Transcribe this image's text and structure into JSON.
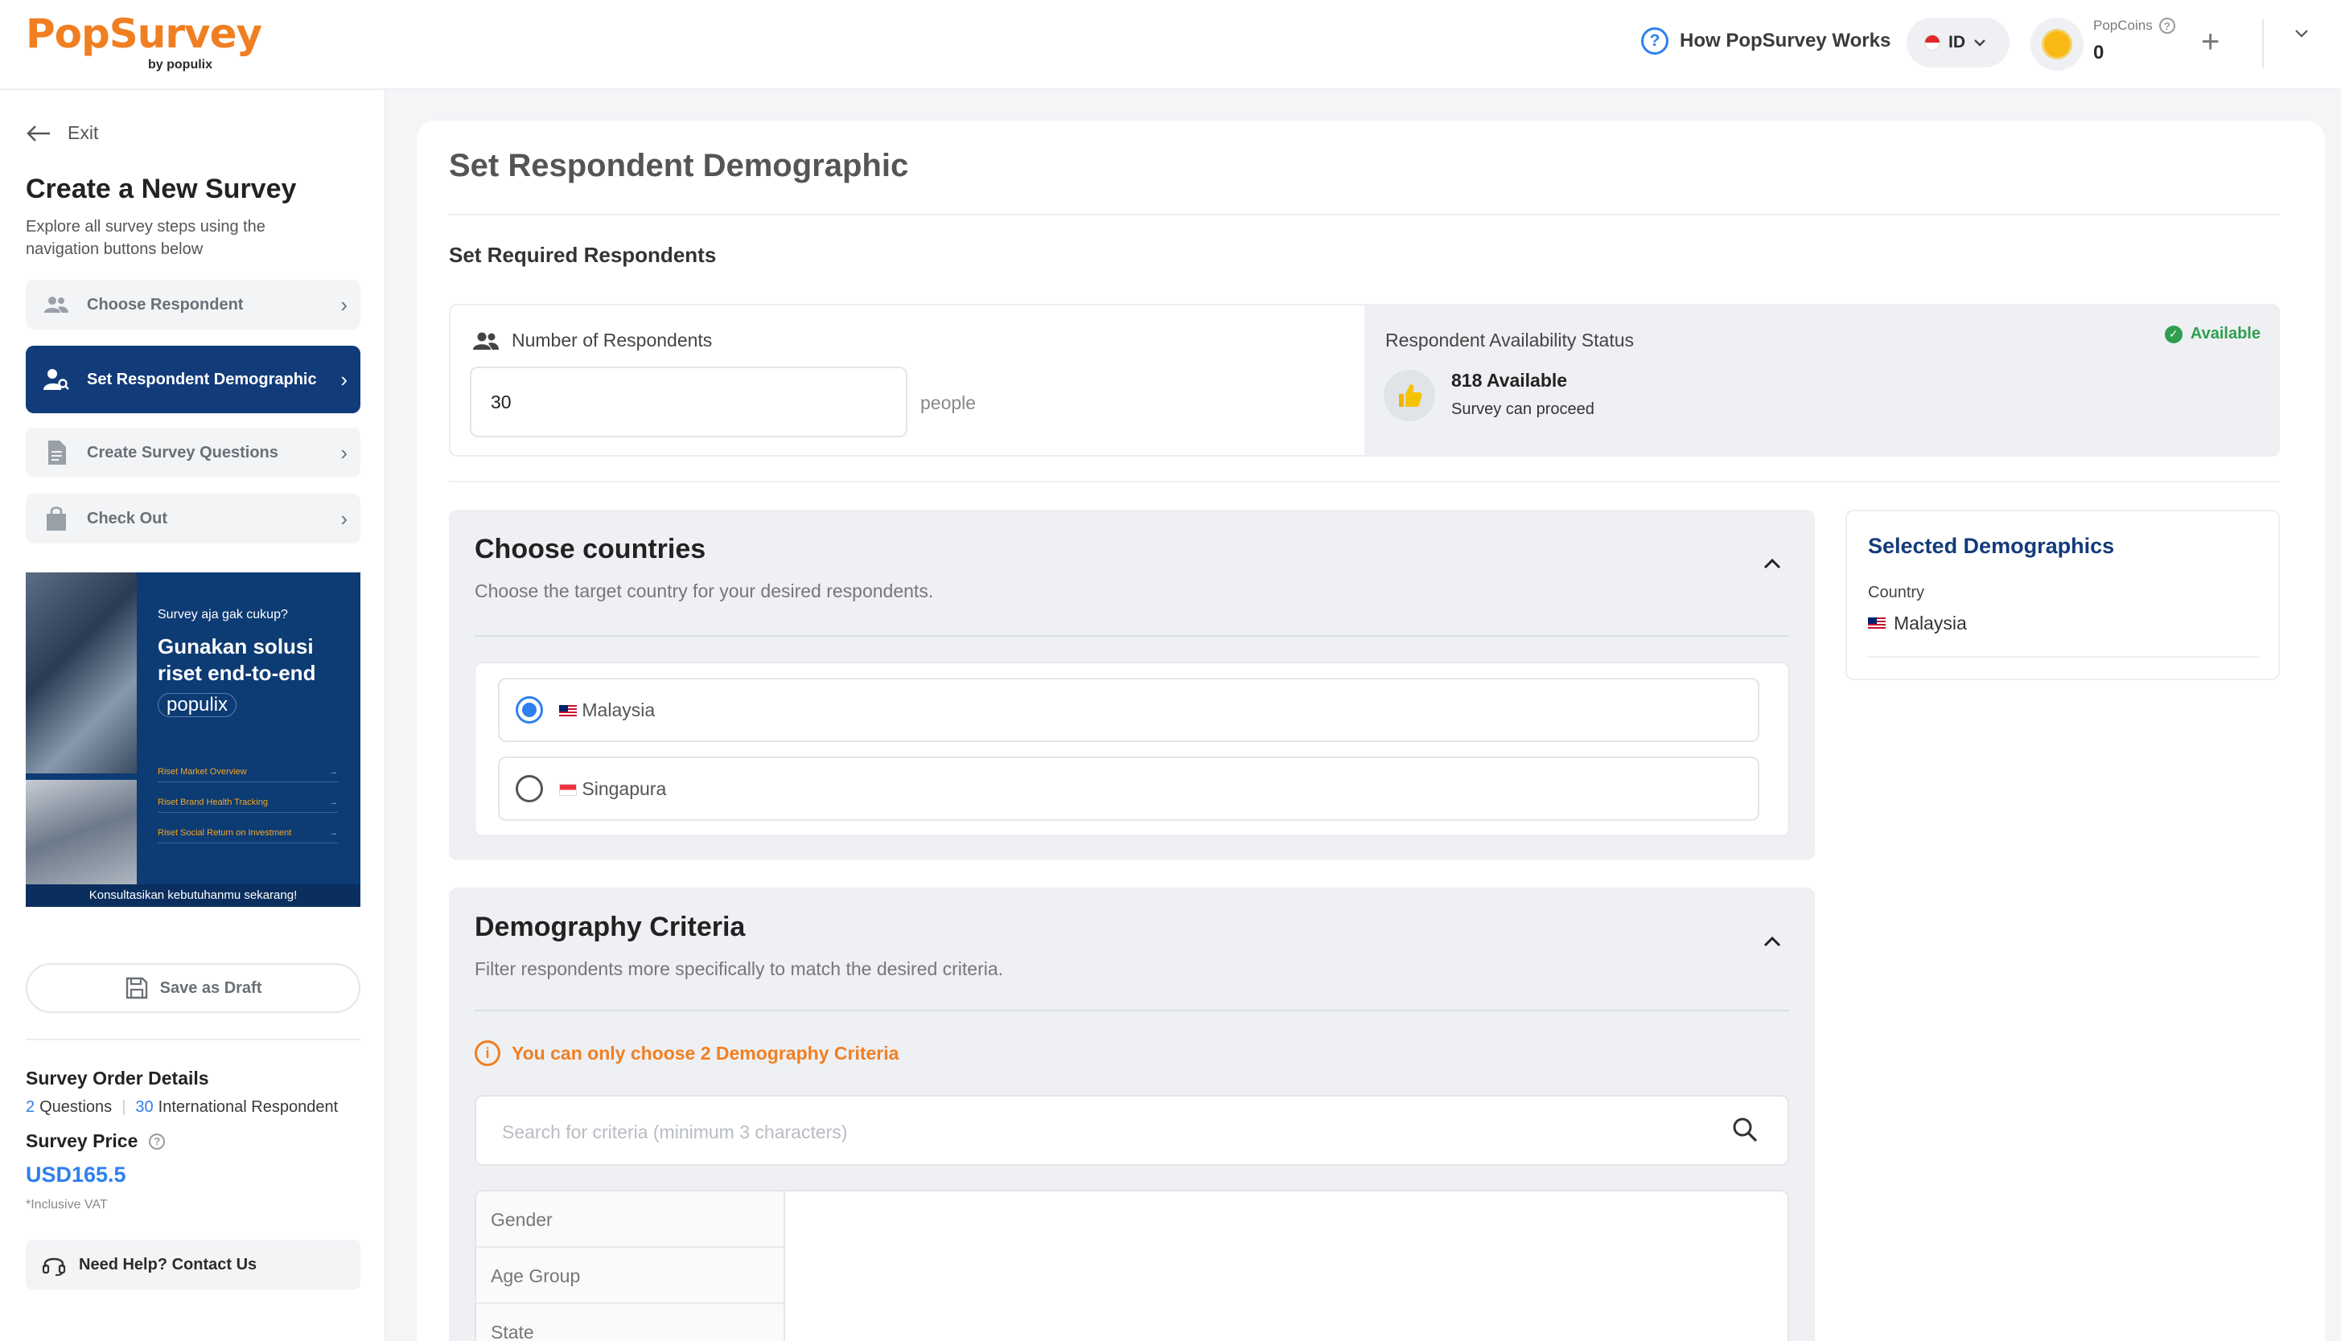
{
  "header": {
    "logo_text": "PopSurvey",
    "logo_sub": "by populix",
    "how_label": "How PopSurvey Works",
    "lang_code": "ID",
    "popcoins_label": "PopCoins",
    "popcoins_value": "0"
  },
  "sidebar": {
    "exit_label": "Exit",
    "title": "Create a New Survey",
    "description": "Explore all survey steps using the navigation buttons below",
    "steps": [
      {
        "label": "Choose Respondent",
        "icon": "people-icon",
        "active": false
      },
      {
        "label": "Set Respondent Demographic",
        "icon": "person-search-icon",
        "active": true
      },
      {
        "label": "Create Survey Questions",
        "icon": "document-icon",
        "active": false
      },
      {
        "label": "Check Out",
        "icon": "bag-icon",
        "active": false
      }
    ],
    "banner": {
      "question": "Survey aja gak cukup?",
      "headline": "Gunakan solusi riset end-to-end",
      "brand": "populix",
      "links": [
        "Riset Market Overview",
        "Riset Brand Health Tracking",
        "Riset Social Return on Investment"
      ],
      "footer": "Konsultasikan kebutuhanmu sekarang!"
    },
    "save_draft_label": "Save as Draft",
    "order_details_title": "Survey Order Details",
    "questions_count": "2",
    "questions_label": "Questions",
    "respondent_count": "30",
    "respondent_label": "International Respondent",
    "price_title": "Survey Price",
    "price_value": "USD165.5",
    "vat_note": "*Inclusive VAT",
    "help_label": "Need Help? Contact Us"
  },
  "main": {
    "title": "Set Respondent Demographic",
    "required_title": "Set Required Respondents",
    "num_respondents_label": "Number of Respondents",
    "num_respondents_value": "30",
    "unit": "people",
    "availability_label": "Respondent Availability Status",
    "availability_status": "Available",
    "available_count": "818 Available",
    "availability_note": "Survey can proceed",
    "countries": {
      "title": "Choose countries",
      "description": "Choose the target country for your desired respondents.",
      "options": [
        {
          "label": "Malaysia",
          "selected": true
        },
        {
          "label": "Singapura",
          "selected": false
        }
      ]
    },
    "demography": {
      "title": "Demography Criteria",
      "description": "Filter respondents more specifically to match the desired criteria.",
      "warning": "You can only choose 2 Demography Criteria",
      "search_placeholder": "Search for criteria (minimum 3 characters)",
      "criteria": [
        "Gender",
        "Age Group",
        "State"
      ]
    },
    "selected": {
      "title": "Selected Demographics",
      "country_label": "Country",
      "country_value": "Malaysia"
    }
  },
  "colors": {
    "brand_orange": "#f07f22",
    "active_navy": "#123b7a",
    "accent_blue": "#2f80ed",
    "available_green": "#2e9e4f"
  }
}
